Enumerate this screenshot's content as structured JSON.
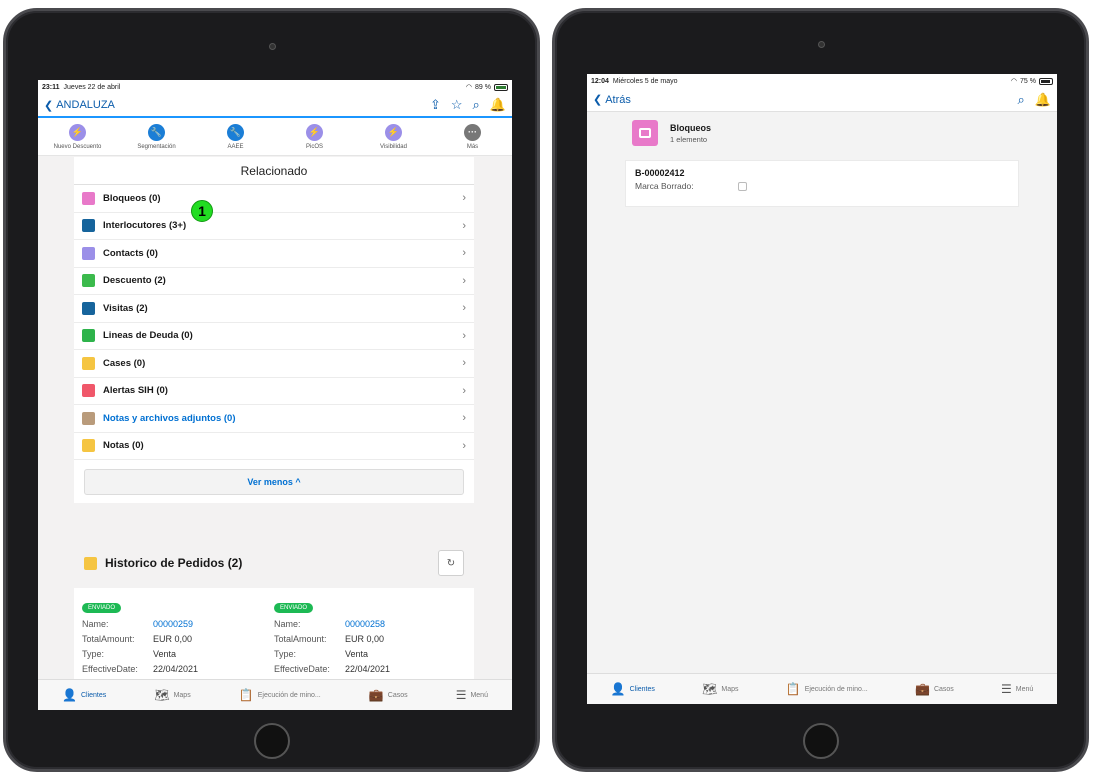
{
  "left": {
    "status": {
      "time": "23:11",
      "date": "Jueves 22 de abril",
      "battery": "89 %"
    },
    "nav": {
      "back_label": "ANDALUZA"
    },
    "actions": [
      {
        "label": "Nuevo Descuento",
        "color": "#9b8fe8",
        "icon": "⚡"
      },
      {
        "label": "Segmentación",
        "color": "#1b7ed6",
        "icon": "🔧"
      },
      {
        "label": "AAEE",
        "color": "#1b7ed6",
        "icon": "🔧"
      },
      {
        "label": "PicOS",
        "color": "#9b8fe8",
        "icon": "⚡"
      },
      {
        "label": "Visibilidad",
        "color": "#9b8fe8",
        "icon": "⚡"
      },
      {
        "label": "Más",
        "color": "#777777",
        "icon": "···"
      }
    ],
    "related": {
      "title": "Relacionado",
      "items": [
        {
          "label": "Bloqueos (0)",
          "color": "#e879c9"
        },
        {
          "label": "Interlocutores (3+)",
          "color": "#16649c"
        },
        {
          "label": "Contacts (0)",
          "color": "#9b8fe8"
        },
        {
          "label": "Descuento (2)",
          "color": "#3bba4c"
        },
        {
          "label": "Visitas (2)",
          "color": "#16649c"
        },
        {
          "label": "Lineas de Deuda (0)",
          "color": "#2eb34b"
        },
        {
          "label": "Cases (0)",
          "color": "#f5c542"
        },
        {
          "label": "Alertas SIH (0)",
          "color": "#f0576a"
        },
        {
          "label": "Notas y archivos adjuntos (0)",
          "color": "#b99b7b"
        },
        {
          "label": "Notas (0)",
          "color": "#f5c542"
        }
      ],
      "ver_menos": "Ver menos ^"
    },
    "callout": "1",
    "historico": {
      "title": "Historico de Pedidos (2)",
      "orders": [
        {
          "status": "ENVIADO",
          "name_key": "Name:",
          "name": "00000259",
          "amount_key": "TotalAmount:",
          "amount": "EUR 0,00",
          "type_key": "Type:",
          "type": "Venta",
          "date_key": "EffectiveDate:",
          "date": "22/04/2021"
        },
        {
          "status": "ENVIADO",
          "name_key": "Name:",
          "name": "00000258",
          "amount_key": "TotalAmount:",
          "amount": "EUR 0,00",
          "type_key": "Type:",
          "type": "Venta",
          "date_key": "EffectiveDate:",
          "date": "22/04/2021"
        }
      ]
    },
    "tabs": [
      {
        "label": "Clientes",
        "icon": "👤"
      },
      {
        "label": "Maps",
        "icon": "🗺"
      },
      {
        "label": "Ejecución de mino...",
        "icon": "📋"
      },
      {
        "label": "Casos",
        "icon": "💼"
      },
      {
        "label": "Menú",
        "icon": "☰"
      }
    ]
  },
  "right": {
    "status": {
      "time": "12:04",
      "date": "Miércoles 5 de mayo",
      "battery": "75 %"
    },
    "nav": {
      "back_label": "Atrás"
    },
    "object": {
      "title": "Bloqueos",
      "count": "1 elemento"
    },
    "record": {
      "id": "B-00002412",
      "field_label": "Marca Borrado:"
    },
    "tabs": [
      {
        "label": "Clientes",
        "icon": "👤"
      },
      {
        "label": "Maps",
        "icon": "🗺"
      },
      {
        "label": "Ejecución de mino...",
        "icon": "📋"
      },
      {
        "label": "Casos",
        "icon": "💼"
      },
      {
        "label": "Menú",
        "icon": "☰"
      }
    ]
  }
}
